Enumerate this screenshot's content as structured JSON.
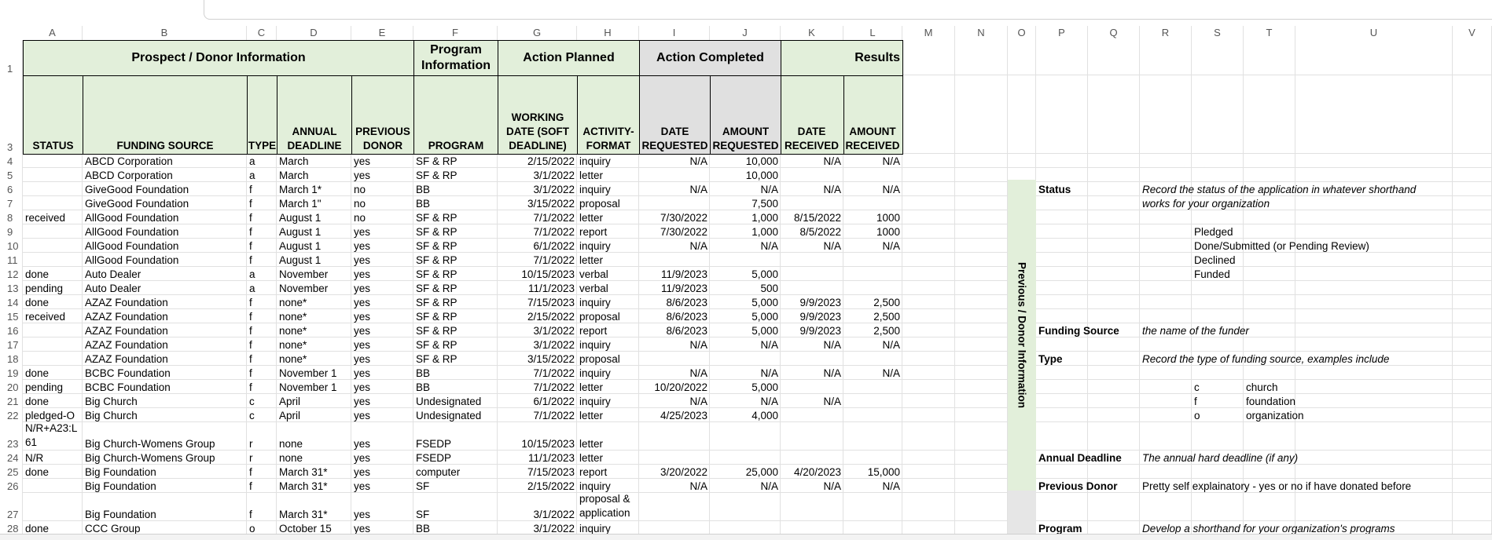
{
  "columns": [
    "A",
    "B",
    "C",
    "D",
    "E",
    "F",
    "G",
    "H",
    "I",
    "J",
    "K",
    "L",
    "M",
    "N",
    "O",
    "P",
    "Q",
    "R",
    "S",
    "T",
    "U",
    "V"
  ],
  "row_numbers": [
    "1",
    "3",
    "4",
    "5",
    "6",
    "7",
    "8",
    "9",
    "10",
    "11",
    "12",
    "13",
    "14",
    "15",
    "16",
    "17",
    "18",
    "19",
    "20",
    "21",
    "22",
    "23",
    "24",
    "25",
    "26",
    "27",
    "28"
  ],
  "group_headers": {
    "prospect": "Prospect / Donor Information",
    "program": "Program Information",
    "planned": "Action Planned",
    "completed": "Action Completed",
    "results": "Results"
  },
  "sub_headers": [
    "STATUS",
    "FUNDING SOURCE",
    "TYPE",
    "ANNUAL DEADLINE",
    "PREVIOUS DONOR",
    "PROGRAM",
    "WORKING DATE (SOFT DEADLINE)",
    "ACTIVITY-FORMAT",
    "DATE REQUESTED",
    "AMOUNT REQUESTED",
    "DATE RECEIVED",
    "AMOUNT RECEIVED"
  ],
  "rows": [
    [
      "",
      "ABCD Corporation",
      "a",
      "March",
      "yes",
      "SF & RP",
      "2/15/2022",
      "inquiry",
      "N/A",
      "10,000",
      "N/A",
      "N/A"
    ],
    [
      "",
      "ABCD Corporation",
      "a",
      "March",
      "yes",
      "SF & RP",
      "3/1/2022",
      "letter",
      "",
      "10,000",
      "",
      ""
    ],
    [
      "",
      "GiveGood Foundation",
      "f",
      "March 1*",
      "no",
      "BB",
      "3/1/2022",
      "inquiry",
      "N/A",
      "N/A",
      "N/A",
      "N/A"
    ],
    [
      "",
      "GiveGood Foundation",
      "f",
      "March 1\"",
      "no",
      "BB",
      "3/15/2022",
      "proposal",
      "",
      "7,500",
      "",
      ""
    ],
    [
      "received",
      "AllGood Foundation",
      "f",
      "August 1",
      "no",
      "SF & RP",
      "7/1/2022",
      "letter",
      "7/30/2022",
      "1,000",
      "8/15/2022",
      "1000"
    ],
    [
      "",
      "AllGood Foundation",
      "f",
      "August 1",
      "yes",
      "SF & RP",
      "7/1/2022",
      "report",
      "7/30/2022",
      "1,000",
      "8/5/2022",
      "1000"
    ],
    [
      "",
      "AllGood Foundation",
      "f",
      "August 1",
      "yes",
      "SF & RP",
      "6/1/2022",
      "inquiry",
      "N/A",
      "N/A",
      "N/A",
      "N/A"
    ],
    [
      "",
      "AllGood Foundation",
      "f",
      "August 1",
      "yes",
      "SF & RP",
      "7/1/2022",
      "letter",
      "",
      "",
      "",
      ""
    ],
    [
      "done",
      "Auto Dealer",
      "a",
      "November",
      "yes",
      "SF & RP",
      "10/15/2023",
      "verbal",
      "11/9/2023",
      "5,000",
      "",
      ""
    ],
    [
      "pending",
      "Auto Dealer",
      "a",
      "November",
      "yes",
      "SF & RP",
      "11/1/2023",
      "verbal",
      "11/9/2023",
      "500",
      "",
      ""
    ],
    [
      "done",
      "AZAZ Foundation",
      "f",
      "none*",
      "yes",
      "SF & RP",
      "7/15/2023",
      "inquiry",
      "8/6/2023",
      "5,000",
      "9/9/2023",
      "2,500"
    ],
    [
      "received",
      "AZAZ Foundation",
      "f",
      "none*",
      "yes",
      "SF & RP",
      "2/15/2022",
      "proposal",
      "8/6/2023",
      "5,000",
      "9/9/2023",
      "2,500"
    ],
    [
      "",
      "AZAZ Foundation",
      "f",
      "none*",
      "yes",
      "SF & RP",
      "3/1/2022",
      "report",
      "8/6/2023",
      "5,000",
      "9/9/2023",
      "2,500"
    ],
    [
      "",
      "AZAZ Foundation",
      "f",
      "none*",
      "yes",
      "SF & RP",
      "3/1/2022",
      "inquiry",
      "N/A",
      "N/A",
      "N/A",
      "N/A"
    ],
    [
      "",
      "AZAZ Foundation",
      "f",
      "none*",
      "yes",
      "SF & RP",
      "3/15/2022",
      "proposal",
      "",
      "",
      "",
      ""
    ],
    [
      "done",
      "BCBC Foundation",
      "f",
      "November 1",
      "yes",
      "BB",
      "7/1/2022",
      "inquiry",
      "N/A",
      "N/A",
      "N/A",
      "N/A"
    ],
    [
      "pending",
      "BCBC Foundation",
      "f",
      "November 1",
      "yes",
      "BB",
      "7/1/2022",
      "letter",
      "10/20/2022",
      "5,000",
      "",
      ""
    ],
    [
      "done",
      "Big Church",
      "c",
      "April",
      "yes",
      "Undesignated",
      "6/1/2022",
      "inquiry",
      "N/A",
      "N/A",
      "N/A",
      ""
    ],
    [
      "pledged-O",
      "Big Church",
      "c",
      "April",
      "yes",
      "Undesignated",
      "7/1/2022",
      "letter",
      "4/25/2023",
      "4,000",
      "",
      ""
    ],
    [
      "N/R+A23:L|61",
      "Big Church-Womens Group",
      "r",
      "none",
      "yes",
      "FSEDP",
      "10/15/2023",
      "letter",
      "",
      "",
      "",
      ""
    ],
    [
      "N/R",
      "Big Church-Womens Group",
      "r",
      "none",
      "yes",
      "FSEDP",
      "11/1/2023",
      "letter",
      "",
      "",
      "",
      ""
    ],
    [
      "done",
      "Big Foundation",
      "f",
      "March 31*",
      "yes",
      "computer",
      "7/15/2023",
      "report",
      "3/20/2022",
      "25,000",
      "4/20/2023",
      "15,000"
    ],
    [
      "",
      "Big Foundation",
      "f",
      "March 31*",
      "yes",
      "SF",
      "2/15/2022",
      "inquiry",
      "N/A",
      "N/A",
      "N/A",
      "N/A"
    ],
    [
      "",
      "Big Foundation",
      "f",
      "March 31*",
      "yes",
      "SF",
      "3/1/2022",
      "proposal &|application",
      "",
      "",
      "",
      ""
    ],
    [
      "done",
      "CCC Group",
      "o",
      "October 15",
      "yes",
      "BB",
      "3/1/2022",
      "inquiry",
      "",
      "",
      "",
      ""
    ]
  ],
  "legend": {
    "vertical_title": "Previous / Donor Information",
    "status_label": "Status",
    "status_desc_1": "Record the status of the application in whatever shorthand",
    "status_desc_2": "works for your organization",
    "status_opts": [
      "Pledged",
      "Done/Submitted (or Pending Review)",
      "Declined",
      "Funded"
    ],
    "funding_label": "Funding Source",
    "funding_desc": "the name of the funder",
    "type_label": "Type",
    "type_desc": "Record the type of funding source, examples include",
    "type_codes": [
      [
        "c",
        "church"
      ],
      [
        "f",
        "foundation"
      ],
      [
        "o",
        "organization"
      ]
    ],
    "deadline_label": "Annual Deadline",
    "deadline_desc": "The annual hard deadline (if any)",
    "prevdonor_label": "Previous Donor",
    "prevdonor_desc": "Pretty self explainatory - yes or no if have donated before",
    "program_label": "Program",
    "program_desc": "Develop a shorthand for your organization's programs"
  }
}
